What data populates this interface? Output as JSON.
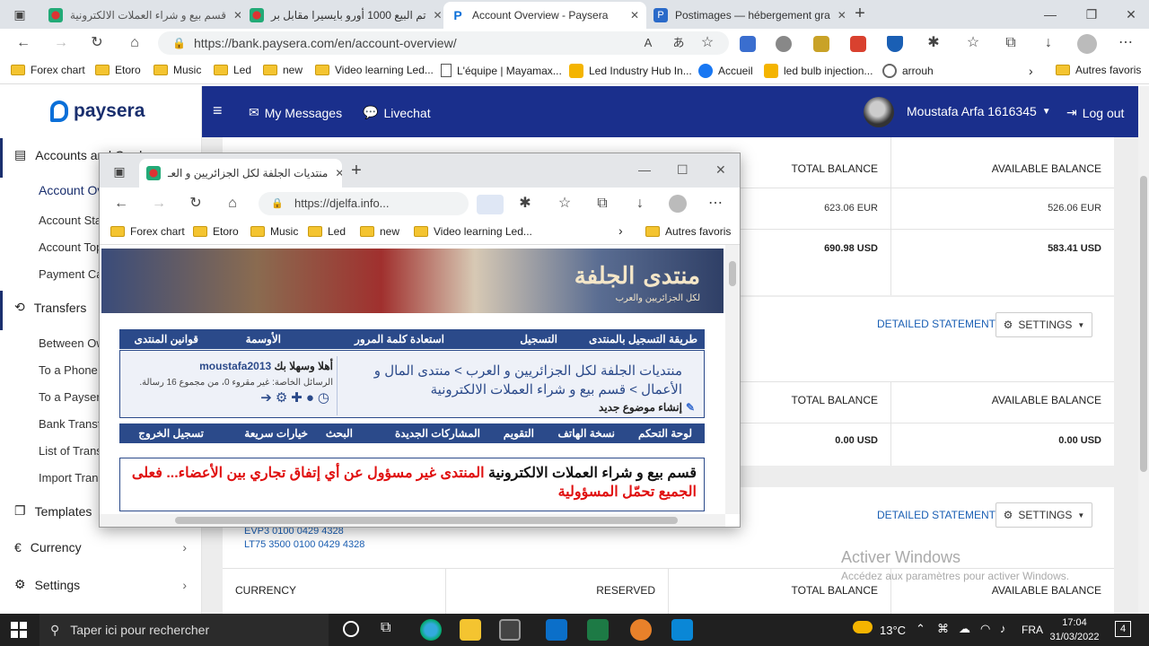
{
  "browser": {
    "tabs": [
      {
        "title": "قسم بيع و شراء العملات الالكترونية",
        "icon": "djelfa-favicon"
      },
      {
        "title": "تم البيع 1000 أورو بايسيرا مقابل بر",
        "icon": "djelfa-favicon"
      },
      {
        "title": "Account Overview - Paysera",
        "icon": "paysera-favicon"
      },
      {
        "title": "Postimages — hébergement gra",
        "icon": "postimages-favicon"
      }
    ],
    "url": "https://bank.paysera.com/en/account-overview/",
    "bookmarks": [
      "Forex chart",
      "Etoro",
      "Music",
      "Led",
      "new",
      "Video learning Led...",
      "L'équipe | Mayamax...",
      "Led Industry Hub In...",
      "Accueil",
      "led bulb injection...",
      "arrouh"
    ],
    "bookmarks_more": "Autres favoris"
  },
  "paysera": {
    "logo": "paysera",
    "nav": {
      "my_messages": "My Messages",
      "livechat": "Livechat",
      "user": "Moustafa Arfa 1616345",
      "logout": "Log out"
    },
    "sidebar": {
      "accounts": "Accounts and Cards",
      "account_items": [
        "Account Overview",
        "Account Statement",
        "Account Top-up",
        "Payment Cards"
      ],
      "transfers": "Transfers",
      "transfer_items": [
        "Between Own",
        "To a Phone",
        "To a Paysera",
        "Bank Transfer",
        "List of Transfers",
        "Import Transfers"
      ],
      "templates": "Templates",
      "currency": "Currency",
      "settings": "Settings"
    },
    "card1": {
      "headers": [
        "TOTAL BALANCE",
        "AVAILABLE BALANCE"
      ],
      "rows": [
        {
          "total": "623.06 EUR",
          "available": "526.06 EUR"
        },
        {
          "total": "690.98 USD",
          "available": "583.41 USD"
        }
      ]
    },
    "card2": {
      "detailed": "DETAILED STATEMENT",
      "settings": "SETTINGS",
      "headers": [
        "TOTAL BALANCE",
        "AVAILABLE BALANCE"
      ],
      "row": {
        "total": "0.00 USD",
        "available": "0.00 USD"
      }
    },
    "card3": {
      "detailed": "DETAILED STATEMENT",
      "settings": "SETTINGS",
      "iban1": "EVP3 0100 0429 4328",
      "iban2": "LT75 3500 0100 0429 4328",
      "headers": [
        "CURRENCY",
        "RESERVED",
        "TOTAL BALANCE",
        "AVAILABLE BALANCE"
      ]
    }
  },
  "watermark": {
    "line1": "Activer Windows",
    "line2": "Accédez aux paramètres pour activer Windows."
  },
  "popup": {
    "tab_title": "منتديات الجلفة لكل الجزائريين و العـ",
    "url": "https://djelfa.info...",
    "bookmarks": [
      "Forex chart",
      "Etoro",
      "Music",
      "Led",
      "new",
      "Video learning Led..."
    ],
    "bookmarks_more": "Autres favoris",
    "banner_text": "منتدى الجلفة",
    "banner_sub": "لكل الجزائريين والعرب",
    "topbar": [
      "طريقة التسجيل بالمنتدى",
      "التسجيل",
      "استعادة كلمة المرور",
      "الأوسمة",
      "قوانين المنتدى"
    ],
    "breadcrumb1": "منتديات الجلفة لكل الجزائريين و العرب > منتدى المال و",
    "breadcrumb2": "الأعمال > قسم بيع و شراء العملات الالكترونية",
    "new_topic": "إنشاء موضوع جديد",
    "welcome": "أهلا وسهلا بك",
    "username": "moustafa2013",
    "pm": "الرسائل الخاصة: غير مقروء 0، من مجموع 16 رسالة.",
    "bottombar": [
      "لوحة التحكم",
      "نسخة الهاتف",
      "التقويم",
      "المشاركات الجديدة",
      "البحث",
      "خيارات سريعة",
      "تسجيل الخروج"
    ],
    "notice_black": "قسم بيع و شراء العملات الالكترونية",
    "notice_red": "المنتدى غير مسؤول عن أي إتفاق تجاري بين الأعضاء... فعلى الجميع تحمّل المسؤولية"
  },
  "taskbar": {
    "search": "Taper ici pour rechercher",
    "weather": "13°C",
    "lang": "FRA",
    "time": "17:04",
    "date": "31/03/2022",
    "notif": "4"
  },
  "colors": {
    "paysera_nav": "#1a2f8c",
    "link": "#1a5fb4",
    "forum_blue": "#2b4a8a",
    "red": "#e01010"
  }
}
